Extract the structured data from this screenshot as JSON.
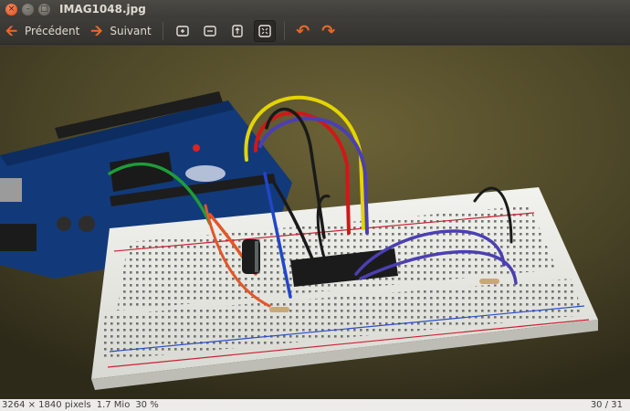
{
  "window": {
    "title": "IMAG1048.jpg",
    "close_glyph": "×",
    "min_glyph": "–",
    "max_glyph": "□"
  },
  "toolbar": {
    "prev_label": "Précédent",
    "next_label": "Suivant",
    "prev_icon": "arrow-left-icon",
    "next_icon": "arrow-right-icon",
    "rotate_left_glyph": "↶",
    "rotate_right_glyph": "↷"
  },
  "status": {
    "dimensions": "3264 × 1840 pixels",
    "filesize": "1.7 Mio",
    "zoom": "30 %",
    "position": "30 / 31"
  },
  "colors": {
    "accent": "#e8692a",
    "titlebar": "#3c3b37",
    "statusbar": "#edeceb"
  }
}
